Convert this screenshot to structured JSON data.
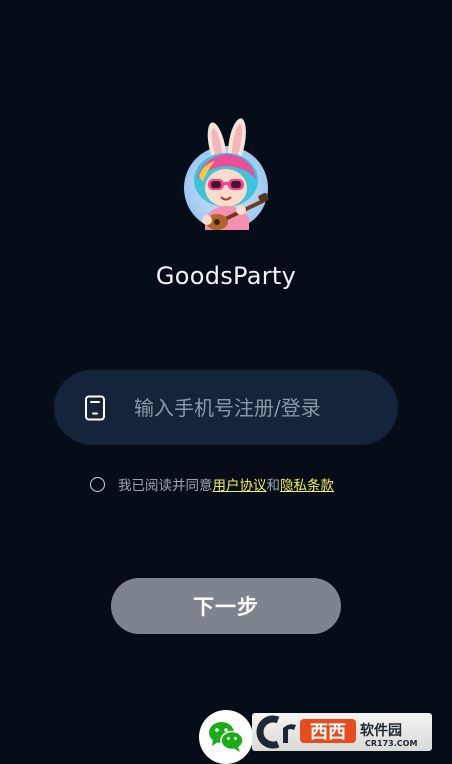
{
  "app": {
    "title": "GoodsParty"
  },
  "login": {
    "phone_placeholder": "输入手机号注册/登录",
    "agree_prefix": "我已阅读并同意",
    "user_agreement_link": "用户协议",
    "and_text": "和",
    "privacy_policy_link": "隐私条款",
    "next_button_label": "下一步"
  },
  "watermark": {
    "brand": "西西",
    "software": "软件园",
    "site": "CR173.COM"
  },
  "icons": {
    "phone": "phone-icon",
    "wechat": "wechat-icon",
    "radio": "radio-unchecked-icon"
  },
  "colors": {
    "background": "#050d18",
    "input_background": "#14243a",
    "link": "#f3ef5c",
    "button": "#7d848d",
    "wechat_green": "#1aad19"
  }
}
